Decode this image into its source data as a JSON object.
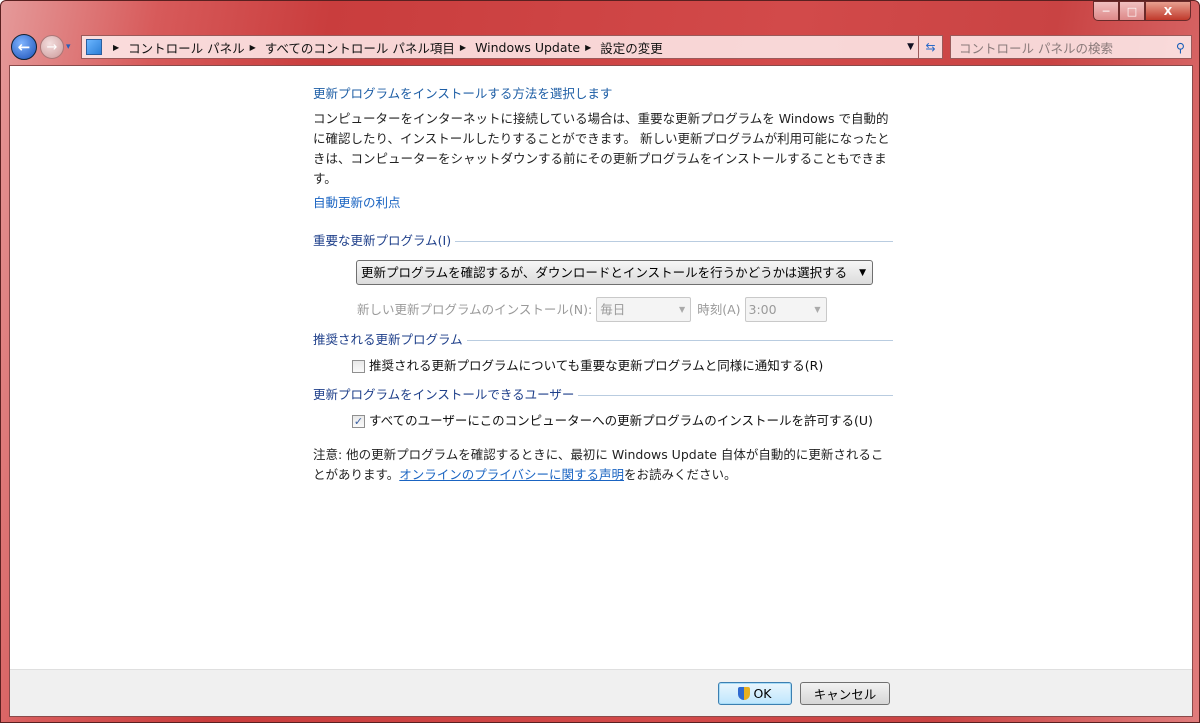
{
  "window": {
    "minimize": "─",
    "maximize": "□",
    "close": "X"
  },
  "nav": {
    "back": "←",
    "forward": "→",
    "history": "▾"
  },
  "breadcrumb": [
    "コントロール パネル",
    "すべてのコントロール パネル項目",
    "Windows Update",
    "設定の変更"
  ],
  "search": {
    "placeholder": "コントロール パネルの検索"
  },
  "main": {
    "title": "更新プログラムをインストールする方法を選択します",
    "description": "コンピューターをインターネットに接続している場合は、重要な更新プログラムを Windows で自動的に確認したり、インストールしたりすることができます。 新しい更新プログラムが利用可能になったときは、コンピューターをシャットダウンする前にその更新プログラムをインストールすることもできます。",
    "benefits_link": "自動更新の利点",
    "important": {
      "heading": "重要な更新プログラム(I)",
      "selected": "更新プログラムを確認するが、ダウンロードとインストールを行うかどうかは選択する",
      "install_label": "新しい更新プログラムのインストール(N):",
      "day": "毎日",
      "time_label": "時刻(A)",
      "time": "3:00"
    },
    "recommended": {
      "heading": "推奨される更新プログラム",
      "checkbox_label": "推奨される更新プログラムについても重要な更新プログラムと同様に通知する(R)",
      "checked": false
    },
    "users": {
      "heading": "更新プログラムをインストールできるユーザー",
      "checkbox_label": "すべてのユーザーにこのコンピューターへの更新プログラムのインストールを許可する(U)",
      "checked": true
    },
    "note_prefix": "注意: 他の更新プログラムを確認するときに、最初に Windows Update 自体が自動的に更新されることがあります。",
    "privacy_link": "オンラインのプライバシーに関する声明",
    "note_suffix": "をお読みください。"
  },
  "footer": {
    "ok": "OK",
    "cancel": "キャンセル"
  },
  "colors": {
    "frame": "#c93d3d",
    "link": "#1a64c2",
    "heading": "#1e3f8a"
  }
}
